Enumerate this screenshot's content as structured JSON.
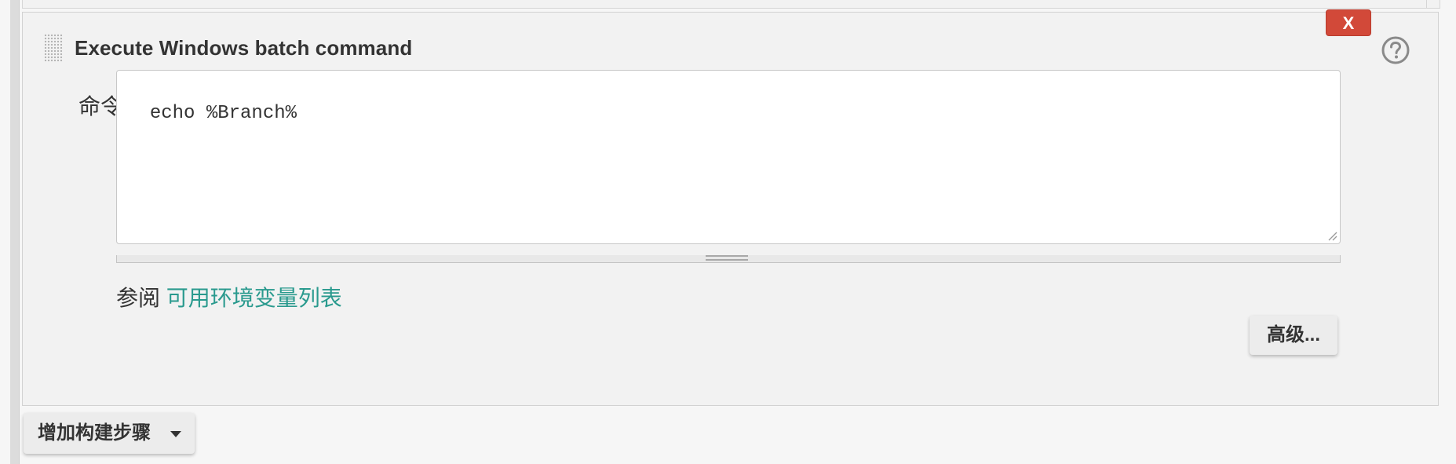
{
  "build_step": {
    "title": "Execute Windows batch command",
    "delete_label": "X",
    "help_icon": "question-circle-icon",
    "drag_icon": "drag-handle-icon",
    "command_label": "命令",
    "command_value": "echo %Branch%",
    "see_also_prefix": "参阅",
    "env_vars_link": "可用环境变量列表",
    "advanced_label": "高级..."
  },
  "add_step": {
    "label": "增加构建步骤",
    "icon": "caret-down-icon"
  },
  "colors": {
    "delete_button": "#d24939",
    "link": "#2a9a8e",
    "panel_background": "#f2f2f2"
  }
}
